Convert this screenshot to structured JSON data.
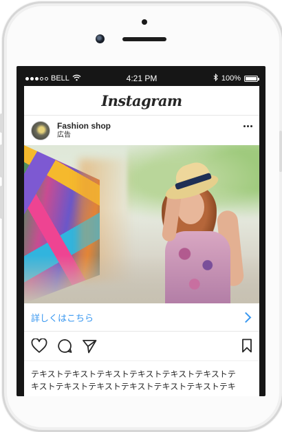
{
  "status_bar": {
    "carrier": "BELL",
    "time": "4:21 PM",
    "battery": "100%",
    "signal_bars_filled": 3,
    "signal_bars_total": 5,
    "battery_level": 1.0
  },
  "app": {
    "title": "Instagram"
  },
  "post": {
    "account_name": "Fashion shop",
    "sponsored_label": "広告",
    "cta_label": "詳しくはこちら",
    "caption_lines": [
      "テキストテキストテキストテキストテキストテキストテ",
      "キストテキストテキストテキストテキストテキストテキ"
    ]
  },
  "colors": {
    "accent": "#3897f0",
    "text": "#262626",
    "status_bar": "#161616"
  },
  "icons": {
    "like": "heart-icon",
    "comment": "comment-icon",
    "share": "send-icon",
    "save": "bookmark-icon",
    "more": "more-icon",
    "wifi": "wifi-icon",
    "bluetooth": "bluetooth-icon",
    "cta": "chevron-right-icon"
  }
}
